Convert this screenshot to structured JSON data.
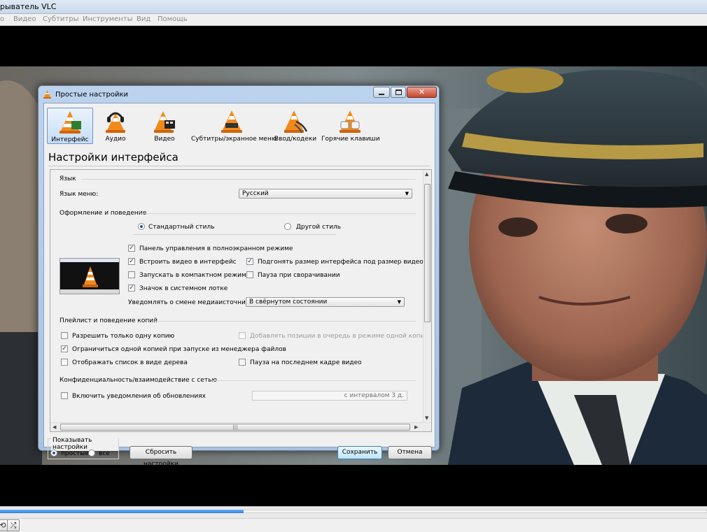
{
  "app": {
    "title": "рыватель VLC",
    "menu": [
      "о",
      "Видео",
      "Субтитры",
      "Инструменты",
      "Вид",
      "Помощь"
    ]
  },
  "player": {
    "progress_percent": 34.5,
    "controls": [
      "loop-icon",
      "shuffle-icon"
    ]
  },
  "dialog": {
    "title": "Простые настройки",
    "close_glyph": "✕",
    "categories": [
      {
        "label": "Интерфейс",
        "icon": "cone-interface-icon",
        "selected": true
      },
      {
        "label": "Аудио",
        "icon": "cone-headphones-icon",
        "selected": false
      },
      {
        "label": "Видео",
        "icon": "cone-film-icon",
        "selected": false
      },
      {
        "label": "Субтитры/экранное меню",
        "icon": "cone-subtitles-icon",
        "selected": false
      },
      {
        "label": "Ввод/кодеки",
        "icon": "cone-cables-icon",
        "selected": false
      },
      {
        "label": "Горячие клавиши",
        "icon": "cone-keys-icon",
        "selected": false
      }
    ],
    "heading": "Настройки интерфейса",
    "language": {
      "group": "Язык",
      "menu_label": "Язык меню:",
      "menu_value": "Русский"
    },
    "look": {
      "group": "Оформление и поведение",
      "style_native": "Стандартный стиль",
      "style_custom": "Другой стиль",
      "fs_controller": "Панель управления в полноэкранном режиме",
      "embed_video": "Встроить видео в интерфейс",
      "resize_interface": "Подгонять размер интерфейса под размер видео",
      "minimal_view": "Запускать в компактном режиме",
      "pause_minimized": "Пауза при сворачивании",
      "systray_icon": "Значок в системном лотке",
      "notify_label": "Уведомлять о смене медиаисточника:",
      "notify_value": "В свёрнутом состоянии"
    },
    "playlist": {
      "group": "Плейлист и поведение копий",
      "one_instance": "Разрешить только одну копию",
      "enqueue": "Добавлять позиции в очередь в режиме одной копии",
      "one_instance_fm": "Ограничиться одной копией при запуске из менеджера файлов",
      "tree_view": "Отображать список в виде дерева",
      "pause_last_frame": "Пауза на последнем кадре видео"
    },
    "privacy": {
      "group": "Конфиденциальность/взаимодействие с сетью",
      "update_notify": "Включить уведомления об обновлениях",
      "interval_value": "с интервалом 3 д."
    },
    "show_settings": {
      "group": "Показывать настройки",
      "simple": "простые",
      "all": "все"
    },
    "buttons": {
      "reset": "Сбросить настройки",
      "save": "Сохранить",
      "cancel": "Отмена"
    },
    "hscroll_grip": "|||"
  }
}
